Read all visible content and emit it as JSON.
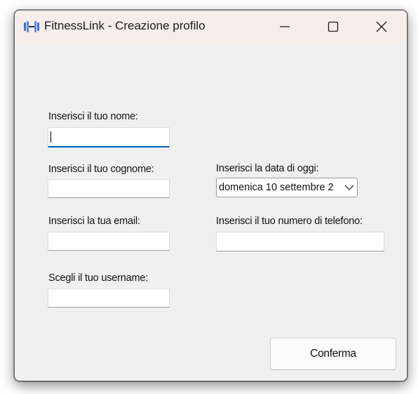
{
  "window": {
    "title": "FitnessLink - Creazione profilo",
    "app_icon": "dumbbell-icon",
    "controls": {
      "minimize": "minimize-icon",
      "maximize": "maximize-icon",
      "close": "close-icon"
    }
  },
  "form": {
    "nome_label": "Inserisci il tuo nome:",
    "nome_value": "",
    "cognome_label": "Inserisci il tuo cognome:",
    "cognome_value": "",
    "email_label": "Inserisci la tua email:",
    "email_value": "",
    "username_label": "Scegli il tuo username:",
    "username_value": "",
    "data_label": "Inserisci la data di oggi:",
    "data_value": "domenica 10 settembre 2",
    "telefono_label": "Inserisci il tuo numero di telefono:",
    "telefono_value": "",
    "confirm_label": "Conferma"
  },
  "colors": {
    "titlebar": "#f7eeec",
    "window_bg": "#f0f0f0",
    "focus_accent": "#005fb8",
    "icon_accent": "#3a6fd8"
  }
}
